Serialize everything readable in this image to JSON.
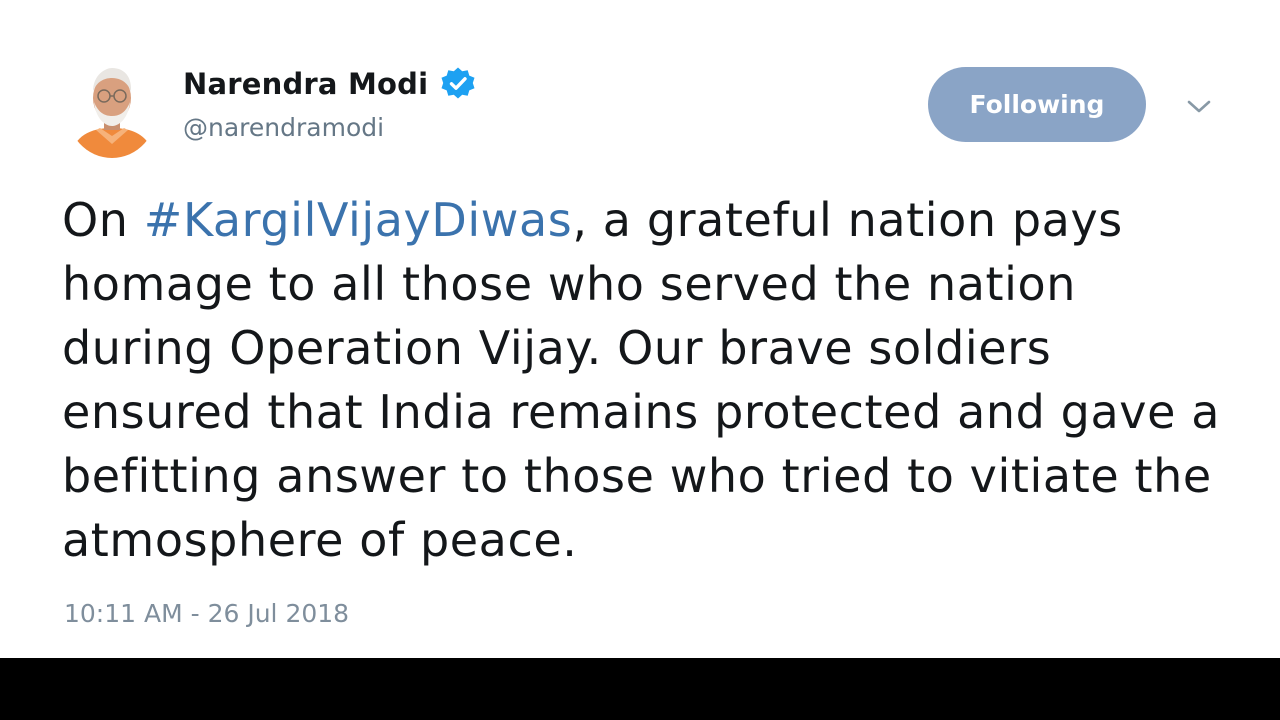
{
  "author": {
    "display_name": "Narendra Modi",
    "handle": "@narendramodi",
    "avatar_icon": "profile-photo",
    "verified_icon": "verified-badge-icon",
    "verified_color": "#1da1f2"
  },
  "follow_button": {
    "label": "Following",
    "background": "#8aa4c6"
  },
  "menu_icon": "chevron-down-icon",
  "tweet": {
    "text_before": "On ",
    "hashtag": "#KargilVijayDiwas",
    "text_after": ", a grateful nation pays homage to all those who served the nation during Operation Vijay. Our brave soldiers ensured that India remains protected and gave a befitting answer to those who tried to vitiate the atmosphere of peace.",
    "hashtag_color": "#3b73ad",
    "timestamp": "10:11 AM - 26 Jul 2018"
  }
}
